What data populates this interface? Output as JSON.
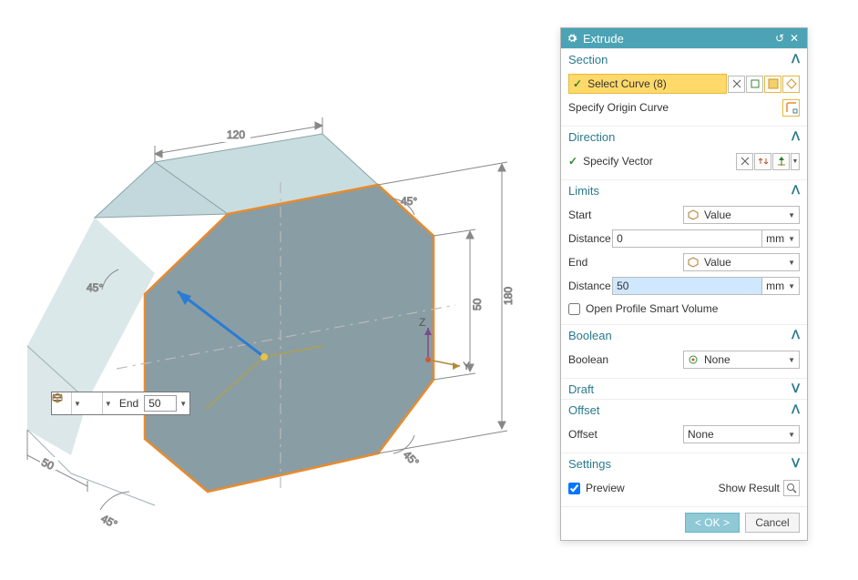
{
  "dialog": {
    "title": "Extrude",
    "sections": {
      "section": {
        "title": "Section",
        "select_curve_label": "Select Curve (8)",
        "specify_origin_label": "Specify Origin Curve"
      },
      "direction": {
        "title": "Direction",
        "specify_vector_label": "Specify Vector"
      },
      "limits": {
        "title": "Limits",
        "start_label": "Start",
        "start_mode": "Value",
        "start_distance_label": "Distance",
        "start_distance_value": "0",
        "end_label": "End",
        "end_mode": "Value",
        "end_distance_label": "Distance",
        "end_distance_value": "50",
        "unit": "mm",
        "open_profile_label": "Open Profile Smart Volume",
        "open_profile_checked": false
      },
      "boolean": {
        "title": "Boolean",
        "label": "Boolean",
        "value": "None"
      },
      "draft": {
        "title": "Draft"
      },
      "offset": {
        "title": "Offset",
        "label": "Offset",
        "value": "None"
      },
      "settings": {
        "title": "Settings",
        "preview_label": "Preview",
        "preview_checked": true,
        "show_result_label": "Show Result"
      }
    },
    "buttons": {
      "ok": "< OK >",
      "cancel": "Cancel"
    }
  },
  "onscreen": {
    "end_label": "End",
    "end_value": "50"
  },
  "sketch": {
    "dims": {
      "top_width": "120",
      "right_inner": "50",
      "right_outer": "180",
      "chamfer_tl": "45°",
      "chamfer_tr": "45°",
      "chamfer_bl": "45°",
      "chamfer_br": "45°",
      "left_depth": "50"
    },
    "axes": {
      "z": "Z",
      "y": "Y"
    }
  },
  "icons": {
    "gear": "gear-icon",
    "reset": "reset-icon",
    "close": "close-icon",
    "collapse_up": "collapse-up-icon",
    "collapse_down": "collapse-down-icon",
    "checkmark": "checkmark-icon",
    "cube": "cube-icon",
    "arrow_dd": "dropdown-arrow-icon",
    "magnifier": "magnifier-icon"
  }
}
